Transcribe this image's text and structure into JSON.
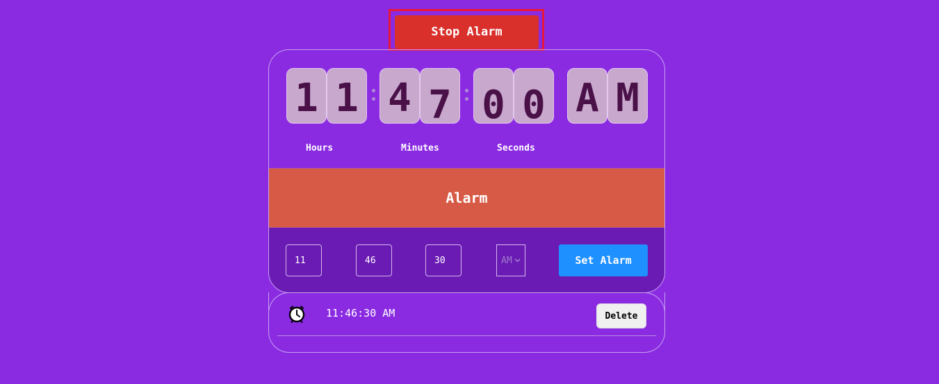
{
  "stop_button": {
    "label": "Stop Alarm"
  },
  "clock": {
    "digits": [
      "1",
      "1",
      "4",
      "7",
      "0",
      "0",
      "A",
      "M"
    ],
    "labels": {
      "hours": "Hours",
      "minutes": "Minutes",
      "seconds": "Seconds"
    }
  },
  "alarm_section": {
    "title": "Alarm"
  },
  "form": {
    "hours_value": "11",
    "minutes_value": "46",
    "seconds_value": "30",
    "ampm_selected": "AM",
    "set_label": "Set Alarm"
  },
  "alarms": [
    {
      "time": "11:46:30 AM",
      "delete_label": "Delete",
      "icon": "alarm-clock-icon"
    }
  ],
  "colors": {
    "background": "#8a2be2",
    "stop_button": "#d9302c",
    "alarm_band": "#d65a45",
    "controls_band": "#6a1bb3",
    "set_button": "#1e90ff",
    "digit_tile": "#c8a8cc",
    "digit_text": "#4a1148"
  }
}
